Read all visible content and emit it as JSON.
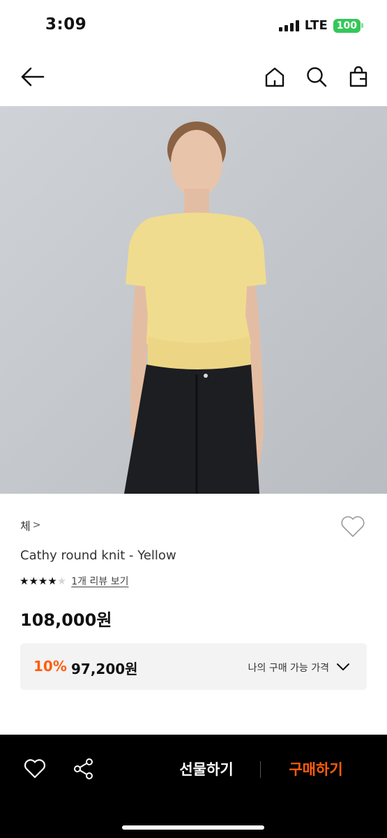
{
  "status_bar": {
    "time": "3:09",
    "network": "LTE",
    "battery": "100",
    "battery_color": "#34c759"
  },
  "nav": {
    "back_icon": "arrow-left-icon",
    "home_icon": "home-icon",
    "search_icon": "search-icon",
    "bag_icon": "shopping-bag-icon"
  },
  "product": {
    "brand": "체",
    "brand_chevron": ">",
    "name": "Cathy round knit - Yellow",
    "rating": 4,
    "rating_max": 5,
    "review_link": "1개 리뷰 보기",
    "price": "108,000원",
    "discount": {
      "rate": "10%",
      "price": "97,200원",
      "my_price_label": "나의 구매 가능 가격"
    }
  },
  "bottom_bar": {
    "gift_label": "선물하기",
    "buy_label": "구매하기",
    "accent_color": "#ff5d0c"
  }
}
